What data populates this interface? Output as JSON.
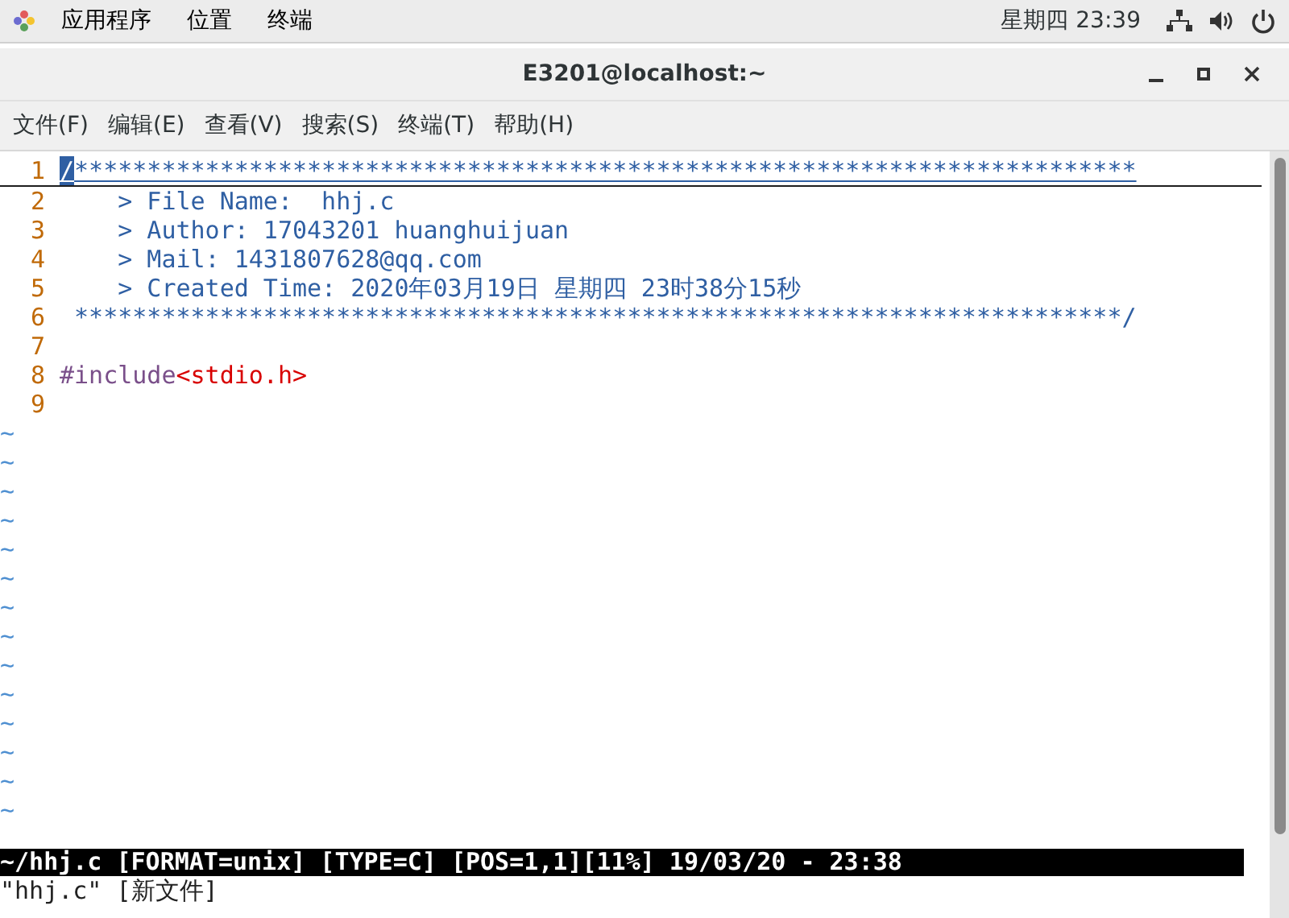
{
  "top_bar": {
    "activities": "应用程序",
    "menus": [
      "位置",
      "终端"
    ],
    "clock": "星期四 23:39"
  },
  "window": {
    "title": "E3201@localhost:~"
  },
  "menu_bar": [
    "文件(F)",
    "编辑(E)",
    "查看(V)",
    "搜索(S)",
    "终端(T)",
    "帮助(H)"
  ],
  "editor": {
    "lines": [
      {
        "number": "1",
        "current": true,
        "segments": [
          {
            "text": "/",
            "kind": "comment",
            "cursor": true
          },
          {
            "text": "*************************************************************************",
            "kind": "comment",
            "cursor": false
          }
        ]
      },
      {
        "number": "2",
        "current": false,
        "segments": [
          {
            "text": "    > File Name:  hhj.c",
            "kind": "comment",
            "cursor": false
          }
        ]
      },
      {
        "number": "3",
        "current": false,
        "segments": [
          {
            "text": "    > Author: 17043201 huanghuijuan",
            "kind": "comment",
            "cursor": false
          }
        ]
      },
      {
        "number": "4",
        "current": false,
        "segments": [
          {
            "text": "    > Mail: 1431807628@qq.com",
            "kind": "comment",
            "cursor": false
          }
        ]
      },
      {
        "number": "5",
        "current": false,
        "segments": [
          {
            "text": "    > Created Time: 2020年03月19日 星期四 23时38分15秒",
            "kind": "comment",
            "cursor": false
          }
        ]
      },
      {
        "number": "6",
        "current": false,
        "segments": [
          {
            "text": " ************************************************************************/",
            "kind": "comment",
            "cursor": false
          }
        ]
      },
      {
        "number": "7",
        "current": false
      },
      {
        "number": "8",
        "current": false,
        "segments": [
          {
            "text": "#include",
            "kind": "preproc",
            "cursor": false
          },
          {
            "text": "<stdio.h>",
            "kind": "string",
            "cursor": false
          }
        ]
      },
      {
        "number": "9",
        "current": false
      }
    ],
    "empty_lines": [
      "~",
      "~",
      "~",
      "~",
      "~",
      "~",
      "~",
      "~",
      "~",
      "~",
      "~",
      "~",
      "~",
      "~"
    ],
    "status_line": "~/hhj.c [FORMAT=unix] [TYPE=C] [POS=1,1][11%] 19/03/20 - 23:38",
    "message": "\"hhj.c\" [新文件]"
  }
}
